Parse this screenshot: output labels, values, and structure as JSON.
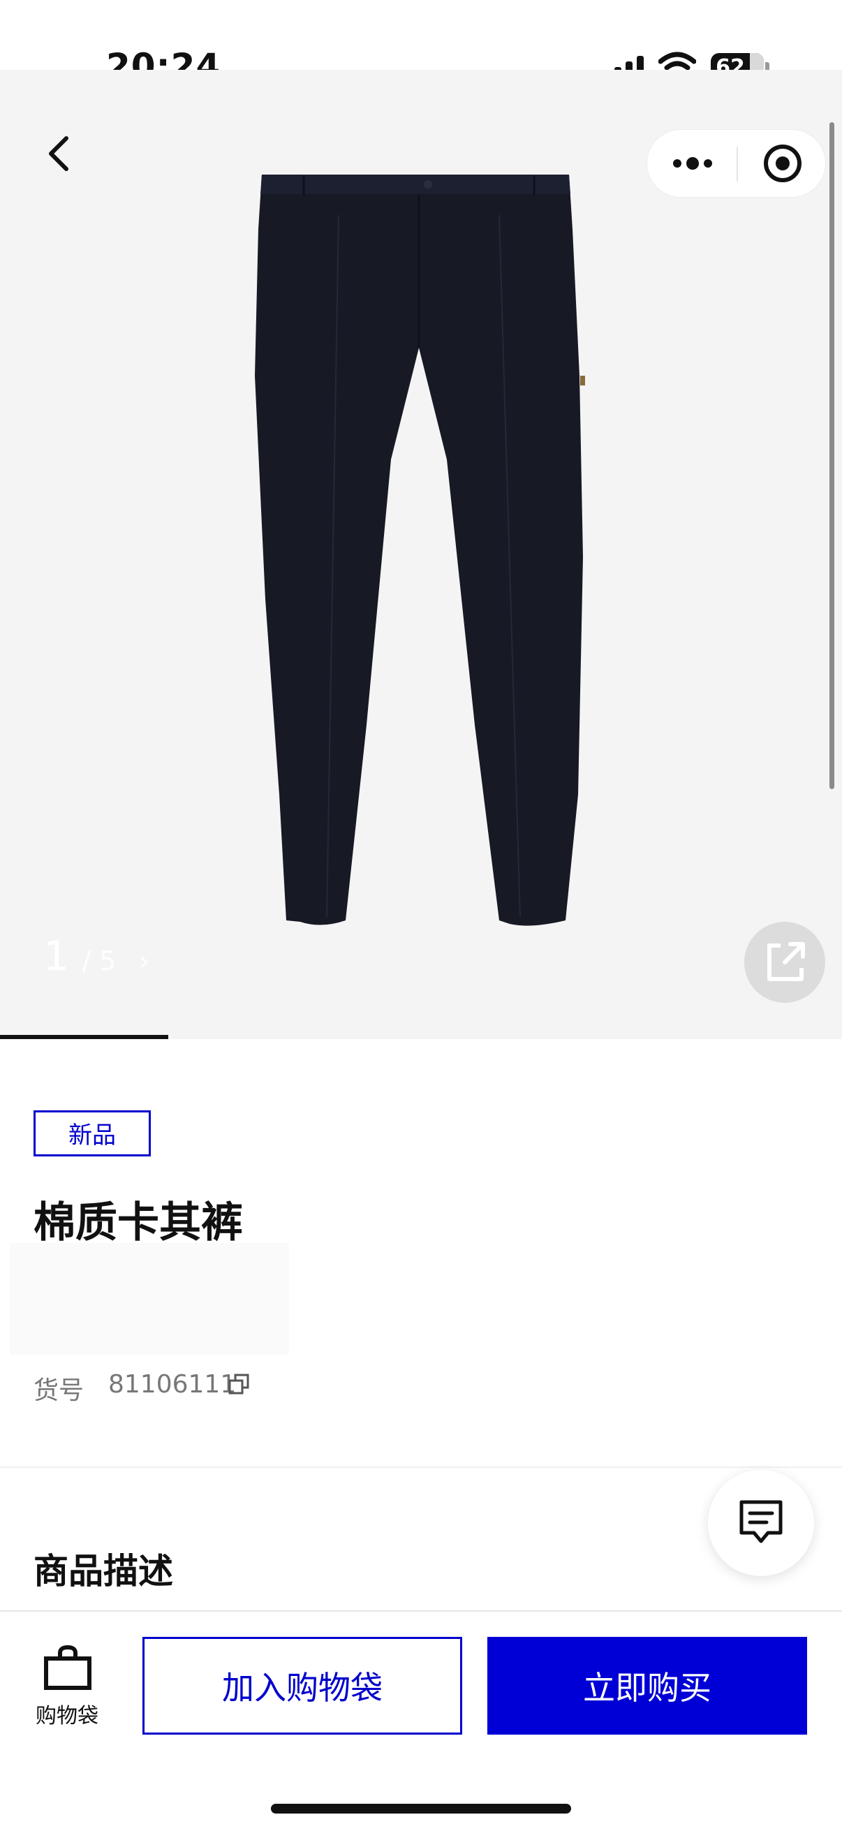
{
  "status_bar": {
    "time": "20:24",
    "battery": "62",
    "battery_level": 0.62
  },
  "gallery": {
    "current": "1",
    "total": "/ 5",
    "next_arrow": "›",
    "progress": 0.2
  },
  "product": {
    "badge": "新品",
    "title": "棉质卡其裤",
    "sku_label": "货号",
    "sku_value": "81106111"
  },
  "section": {
    "description_title": "商品描述"
  },
  "bottom_bar": {
    "bag_label": "购物袋",
    "add_to_bag": "加入购物袋",
    "buy_now": "立即购买"
  },
  "colors": {
    "accent": "#0000d6",
    "gallery_bg": "#f4f4f4",
    "product": "#171a24"
  },
  "icons": [
    "back-icon",
    "more-icon",
    "target-icon",
    "share-icon",
    "copy-icon",
    "chat-icon",
    "bag-icon"
  ]
}
